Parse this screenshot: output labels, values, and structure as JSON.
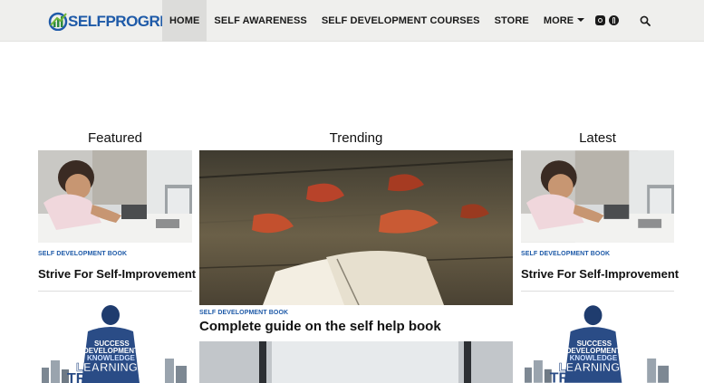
{
  "header": {
    "logo_text_a": "SELF",
    "logo_text_b": "PROGRESS",
    "nav": [
      {
        "label": "HOME",
        "active": true
      },
      {
        "label": "SELF AWARENESS",
        "active": false
      },
      {
        "label": "SELF DEVELOPMENT COURSES",
        "active": false
      },
      {
        "label": "STORE",
        "active": false
      },
      {
        "label": "MORE",
        "active": false
      }
    ],
    "social_icons": [
      "instagram-icon",
      "pinterest-icon"
    ],
    "search_icon": "search-icon"
  },
  "columns": {
    "featured": {
      "title": "Featured",
      "posts": [
        {
          "category": "SELF DEVELOPMENT BOOK",
          "title": "Strive For Self-Improvement"
        }
      ]
    },
    "trending": {
      "title": "Trending",
      "posts": [
        {
          "category": "SELF DEVELOPMENT BOOK",
          "title": "Complete guide on the self help book"
        }
      ]
    },
    "latest": {
      "title": "Latest",
      "posts": [
        {
          "category": "SELF DEVELOPMENT BOOK",
          "title": "Strive For Self-Improvement"
        }
      ]
    }
  },
  "wordcloud": {
    "words": [
      "SUCCESS",
      "DEVELOPMENT",
      "KNOWLEDGE",
      "LEARNING",
      "TRAINING"
    ]
  },
  "colors": {
    "accent": "#1e5aa8",
    "header_bg": "#efefed",
    "active_nav_bg": "#dcdcda"
  }
}
